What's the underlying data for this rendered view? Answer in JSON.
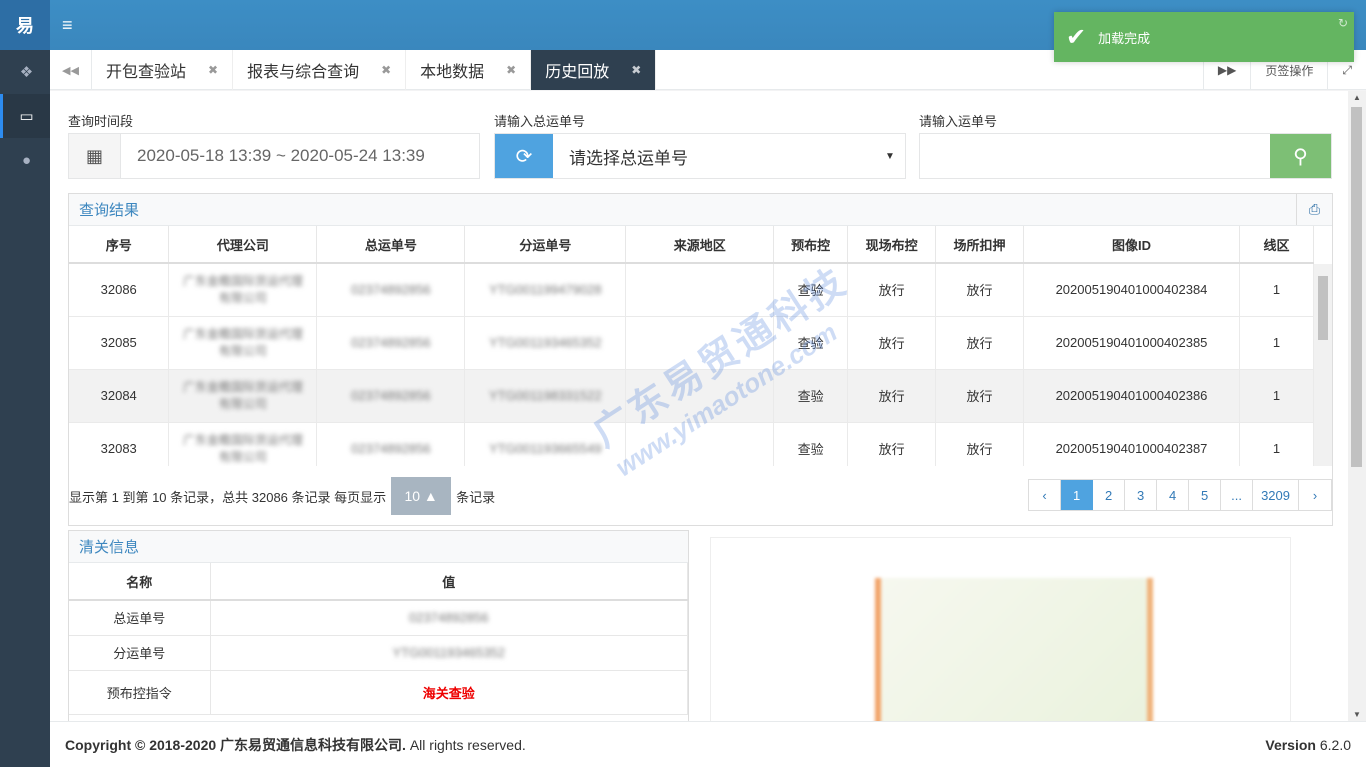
{
  "sidebar": {
    "logo": "易",
    "items": [
      {
        "icon": "cubes-icon",
        "glyph": "❖"
      },
      {
        "icon": "laptop-icon",
        "glyph": "▭"
      },
      {
        "icon": "alert-icon",
        "glyph": "●"
      }
    ]
  },
  "header": {
    "menu_glyph": "≡"
  },
  "toast": {
    "message": "加载完成",
    "check_glyph": "✔",
    "refresh_glyph": "↻"
  },
  "tabs": {
    "left_arrow": "◀◀",
    "items": [
      {
        "label": "开包查验站",
        "close": "✖"
      },
      {
        "label": "报表与综合查询",
        "close": "✖"
      },
      {
        "label": "本地数据",
        "close": "✖"
      },
      {
        "label": "历史回放",
        "close": "✖"
      }
    ],
    "right_arrow": "▶▶",
    "tab_ops": "页签操作",
    "fullscreen_glyph": "⤢"
  },
  "search": {
    "time_label": "查询时间段",
    "time_value": "2020-05-18 13:39  ~  2020-05-24 13:39",
    "calendar_glyph": "▦",
    "master_label": "请输入总运单号",
    "master_value": "请选择总运单号",
    "refresh_glyph": "⟳",
    "caret_glyph": "▼",
    "waybill_label": "请输入运单号",
    "waybill_value": "",
    "search_glyph": "⚲"
  },
  "results": {
    "title": "查询结果",
    "print_glyph": "⎙",
    "columns": [
      "序号",
      "代理公司",
      "总运单号",
      "分运单号",
      "来源地区",
      "预布控",
      "现场布控",
      "场所扣押",
      "图像ID",
      "线区"
    ],
    "rows": [
      {
        "seq": "32086",
        "agent": "广东金瞻国际货运代理有限公司",
        "master": "02374892856",
        "sub": "YTG001199479028",
        "region": "",
        "pre": "查验",
        "onsite": "放行",
        "seize": "放行",
        "image_id": "202005190401000402384",
        "line": "1"
      },
      {
        "seq": "32085",
        "agent": "广东金瞻国际货运代理有限公司",
        "master": "02374892856",
        "sub": "YTG001193465352",
        "region": "",
        "pre": "查验",
        "onsite": "放行",
        "seize": "放行",
        "image_id": "202005190401000402385",
        "line": "1"
      },
      {
        "seq": "32084",
        "agent": "广东金瞻国际货运代理有限公司",
        "master": "02374892856",
        "sub": "YTG001198331522",
        "region": "",
        "pre": "查验",
        "onsite": "放行",
        "seize": "放行",
        "image_id": "202005190401000402386",
        "line": "1"
      },
      {
        "seq": "32083",
        "agent": "广东金瞻国际货运代理有限公司",
        "master": "02374892856",
        "sub": "YTG001193665549",
        "region": "",
        "pre": "查验",
        "onsite": "放行",
        "seize": "放行",
        "image_id": "202005190401000402387",
        "line": "1"
      }
    ],
    "info_prefix": "显示第 1 到第 10 条记录，总共 32086 条记录  每页显示",
    "page_size": "10 ▲",
    "info_suffix": "条记录",
    "pages": [
      "‹",
      "1",
      "2",
      "3",
      "4",
      "5",
      "...",
      "3209",
      "›"
    ],
    "active_page": "1"
  },
  "clearance": {
    "title": "清关信息",
    "columns": [
      "名称",
      "值"
    ],
    "rows": [
      {
        "name": "总运单号",
        "value": "02374892856"
      },
      {
        "name": "分运单号",
        "value": "YTG001193465352"
      },
      {
        "name": "预布控指令",
        "value": "海关查验"
      }
    ]
  },
  "watermark": {
    "cn": "广东易贸通科技",
    "en": "www.yimaotone.com"
  },
  "footer": {
    "copyright_prefix": "Copyright © 2018-2020 广东易贸通信息科技有限公司.",
    "copyright_suffix": " All rights reserved.",
    "version_label": "Version",
    "version": "6.2.0"
  },
  "colors": {
    "header": "#3c8dbc",
    "sidebar": "#2f4050",
    "toast": "#64b561",
    "search_button": "#7dbf75",
    "refresh_button": "#4fa3e0",
    "alert_red": "#e00000"
  }
}
